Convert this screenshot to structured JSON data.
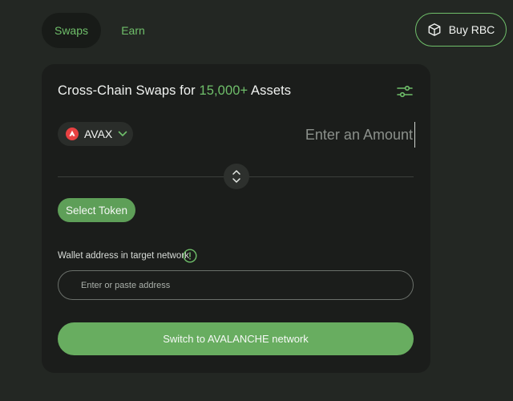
{
  "nav": {
    "tabs": [
      {
        "label": "Swaps",
        "active": true
      },
      {
        "label": "Earn",
        "active": false
      }
    ],
    "buy_button": {
      "label": "Buy RBC",
      "icon": "cube-icon"
    }
  },
  "swap_card": {
    "title_prefix": "Cross-Chain Swaps for ",
    "title_accent": "15,000+",
    "title_suffix": " Assets",
    "settings_icon": "sliders-icon",
    "from_token": {
      "symbol": "AVAX",
      "icon": "avax-icon"
    },
    "amount": {
      "value": "",
      "placeholder": "Enter an Amount"
    },
    "switch_icon": "up-down-chevrons-icon",
    "select_token_label": "Select Token",
    "wallet": {
      "label": "Wallet address in target network",
      "info_icon": "exclamation-circle-icon",
      "placeholder": "Enter or paste address",
      "value": ""
    },
    "action_button_label": "Switch to AVALANCHE network"
  },
  "colors": {
    "background": "#232723",
    "card": "#1b1d1b",
    "accent": "#6fbf6a",
    "button_green": "#68ad60",
    "avax_red": "#e84142"
  }
}
